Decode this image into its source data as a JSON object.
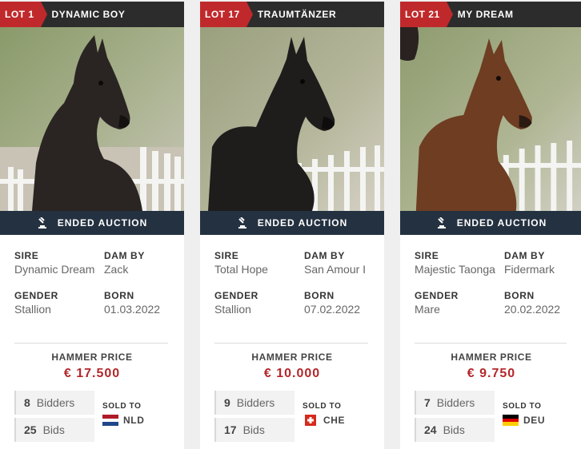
{
  "labels": {
    "sire": "SIRE",
    "dam_by": "DAM BY",
    "gender": "GENDER",
    "born": "BORN",
    "ended_auction": "ENDED AUCTION",
    "hammer_price": "HAMMER PRICE",
    "bidders": "Bidders",
    "bids": "Bids",
    "sold_to": "SOLD TO"
  },
  "colors": {
    "lot_badge": "#c0292b",
    "header_bg": "#2c2c2c",
    "status_bar": "#243140",
    "price": "#b3272a"
  },
  "cards": [
    {
      "lot": "LOT 1",
      "name": "DYNAMIC BOY",
      "sire": "Dynamic Dream",
      "dam_by": "Zack",
      "gender": "Stallion",
      "born": "01.03.2022",
      "hammer_price": "€ 17.500",
      "bidders": "8",
      "bids": "25",
      "country": "NLD",
      "flag_icon": "netherlands-flag-icon"
    },
    {
      "lot": "LOT 17",
      "name": "TRAUMTÄNZER",
      "sire": "Total Hope",
      "dam_by": "San Amour I",
      "gender": "Stallion",
      "born": "07.02.2022",
      "hammer_price": "€ 10.000",
      "bidders": "9",
      "bids": "17",
      "country": "CHE",
      "flag_icon": "switzerland-flag-icon"
    },
    {
      "lot": "LOT 21",
      "name": "MY DREAM",
      "sire": "Majestic Taonga",
      "dam_by": "Fidermark",
      "gender": "Mare",
      "born": "20.02.2022",
      "hammer_price": "€ 9.750",
      "bidders": "7",
      "bids": "24",
      "country": "DEU",
      "flag_icon": "germany-flag-icon"
    }
  ]
}
